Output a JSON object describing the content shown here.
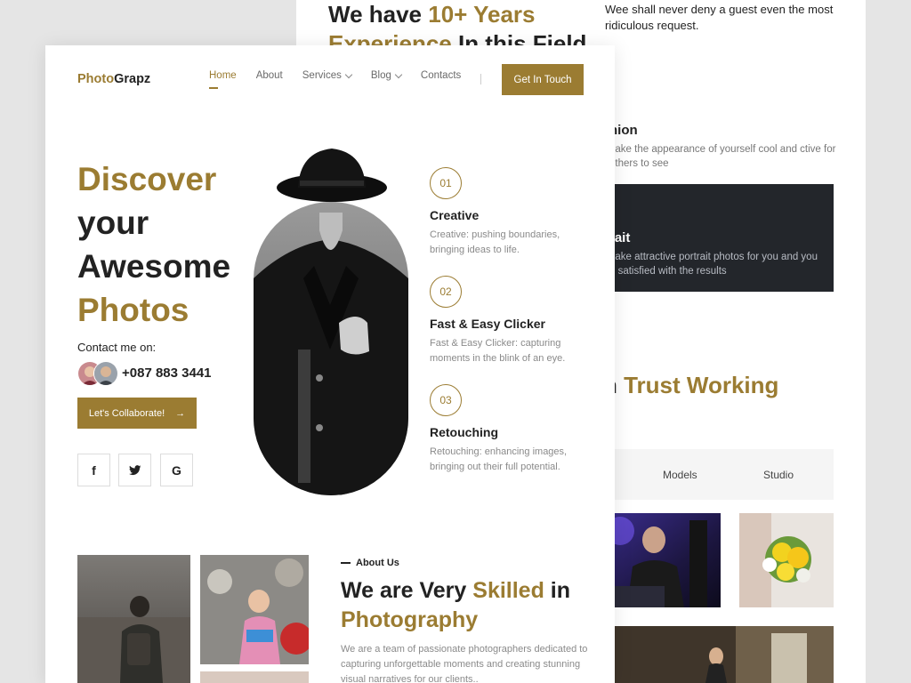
{
  "back_card": {
    "experience": {
      "pre": "We have ",
      "accent": "10+ Years",
      "line2_accent": "Experience",
      "line2_rest": " In this Field"
    },
    "quote": "Wee shall never deny a guest even the most ridiculous request.",
    "fashion": {
      "title": "hion",
      "desc": "nake the appearance of yourself cool and ctive for others to see"
    },
    "portrait": {
      "title": "rait",
      "desc": "nake attractive portrait photos for you and you e satisfied with the results"
    },
    "trust": {
      "pre": "n ",
      "accent": "Trust Working"
    },
    "tabs": [
      "Models",
      "Studio"
    ]
  },
  "header": {
    "logo_part1": "Photo",
    "logo_part2": "Grapz",
    "nav": [
      {
        "label": "Home"
      },
      {
        "label": "About"
      },
      {
        "label": "Services"
      },
      {
        "label": "Blog"
      },
      {
        "label": "Contacts"
      }
    ],
    "cta_label": "Get In Touch"
  },
  "hero": {
    "line1": "Discover",
    "line2": "your",
    "line3": "Awesome",
    "line4": "Photos",
    "contact_label": "Contact me on:",
    "phone": "+087 883 3441",
    "collab_label": "Let's Collaborate!",
    "collab_arrow": "→",
    "social": [
      "f",
      "G"
    ]
  },
  "features": [
    {
      "num": "01",
      "title": "Creative",
      "desc": "Creative: pushing boundaries, bringing ideas to life."
    },
    {
      "num": "02",
      "title": "Fast & Easy Clicker",
      "desc": "Fast & Easy Clicker: capturing moments in the blink of an eye."
    },
    {
      "num": "03",
      "title": "Retouching",
      "desc": "Retouching: enhancing images, bringing out their full potential."
    }
  ],
  "about": {
    "tag": "About Us",
    "title_pre": "We are Very ",
    "title_accent": "Skilled",
    "title_mid": " in",
    "title_accent2": "Photography",
    "desc": "We are a team of passionate photographers dedicated to capturing unforgettable moments and creating stunning visual narratives for our clients.."
  },
  "colors": {
    "accent": "#9b7c32",
    "dark": "#23262b",
    "text": "#222222"
  }
}
